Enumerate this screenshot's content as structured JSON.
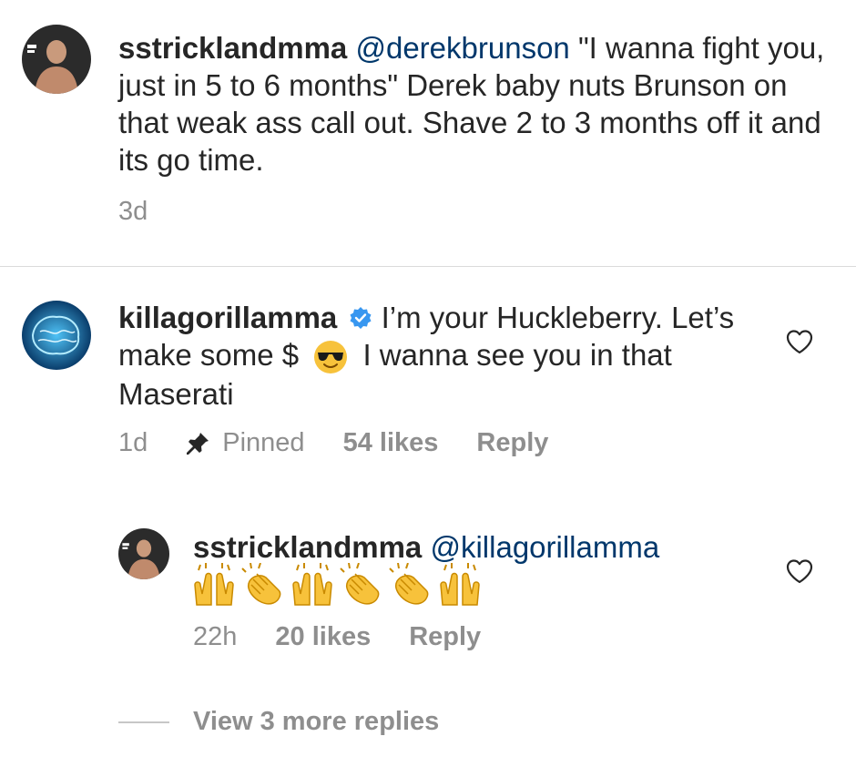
{
  "comments": [
    {
      "username": "sstricklandmma",
      "mention": "@derekbrunson",
      "text": "\"I wanna fight you, just in 5 to 6 months\" Derek baby nuts Brunson on that weak ass call out. Shave 2 to 3 months off it and its go time.",
      "time": "3d"
    },
    {
      "username": "killagorillamma",
      "text_part1": "I’m your Huckleberry. Let’s make some $",
      "text_part2": "I wanna see you in that Maserati",
      "emoji": "sunglasses-face",
      "time": "1d",
      "pinned_label": "Pinned",
      "likes": "54 likes",
      "reply_label": "Reply"
    },
    {
      "username": "sstricklandmma",
      "mention": "@killagorillamma",
      "emojis": [
        "raising-hands",
        "clapping-hands",
        "raising-hands",
        "clapping-hands",
        "clapping-hands",
        "raising-hands"
      ],
      "time": "22h",
      "likes": "20 likes",
      "reply_label": "Reply"
    }
  ],
  "view_more": "View 3 more replies",
  "colors": {
    "text": "#262626",
    "meta": "#8e8e8e",
    "mention": "#00376b",
    "verified": "#3897f0",
    "emoji": "#f7c23b"
  }
}
